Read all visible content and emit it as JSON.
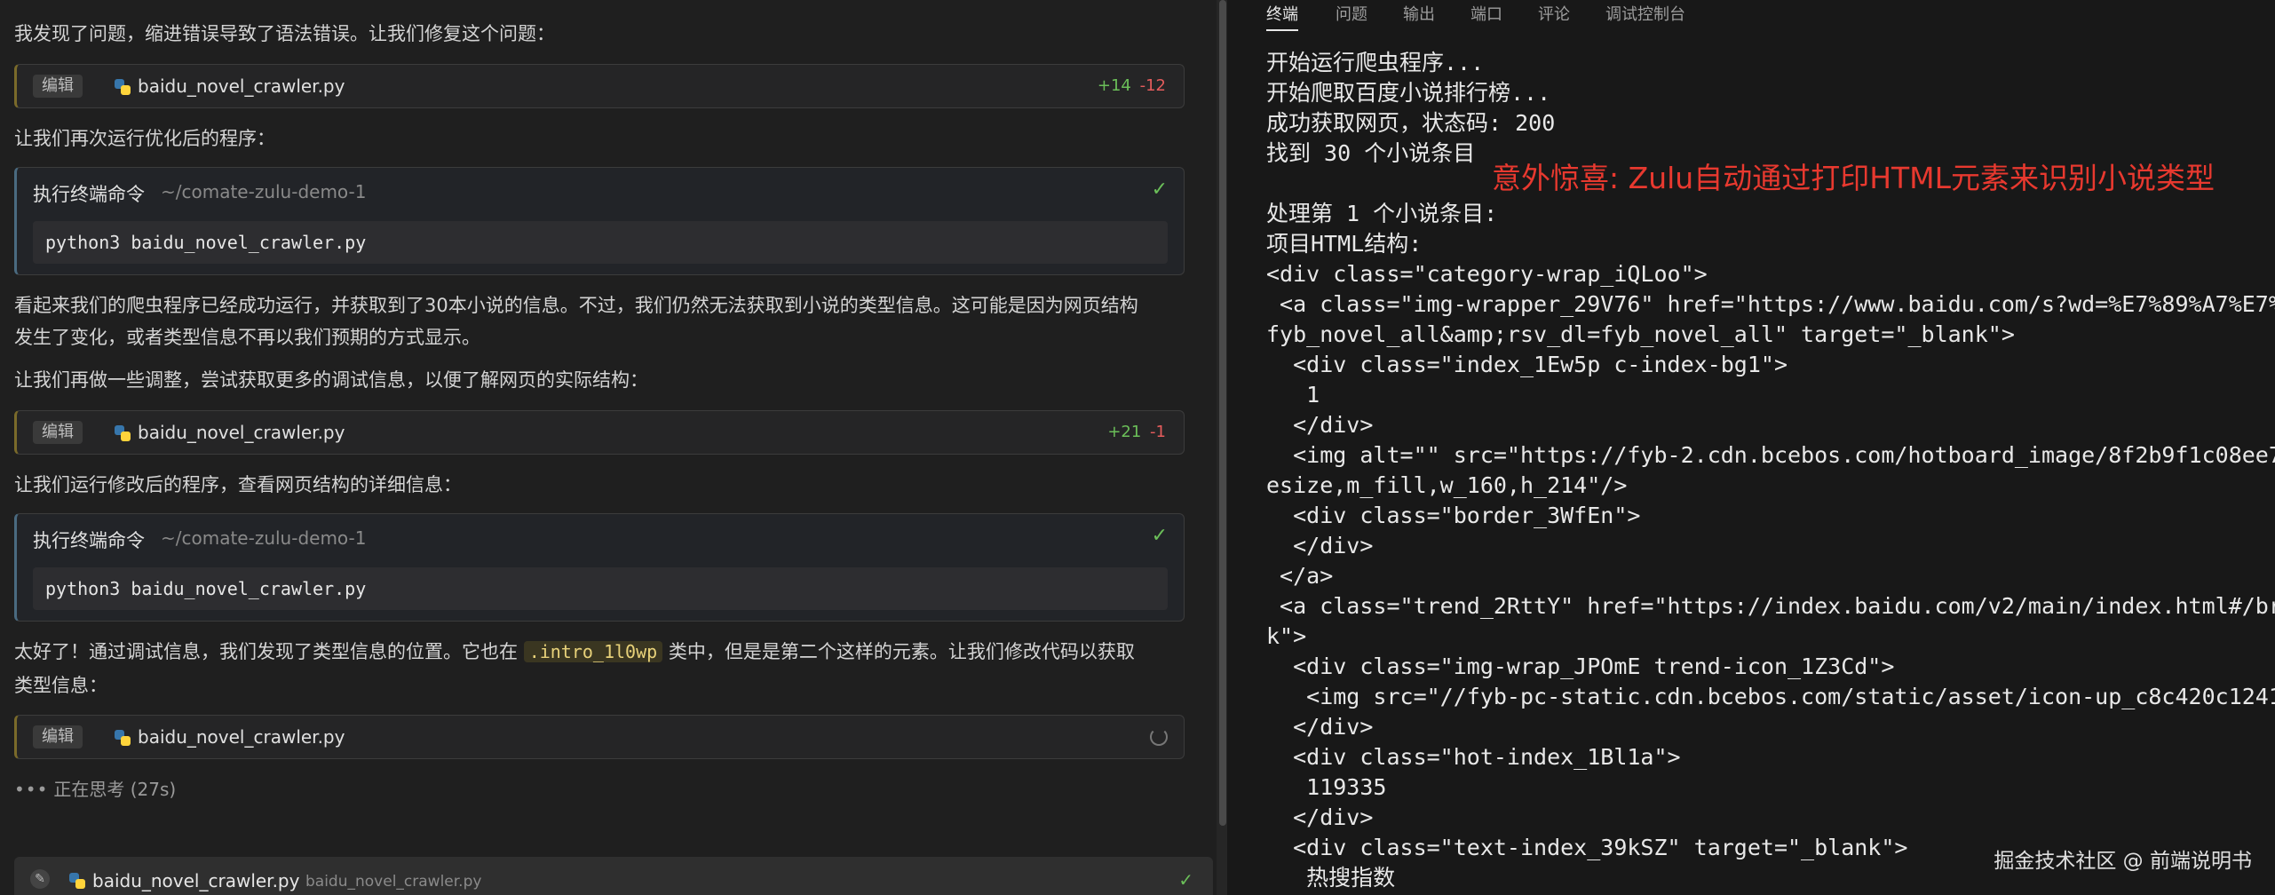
{
  "chat": {
    "msg1": "我发现了问题，缩进错误导致了语法错误。让我们修复这个问题：",
    "edit1": {
      "pill": "编辑",
      "file": "baidu_novel_crawler.py",
      "added": "+14",
      "removed": "-12"
    },
    "msg2": "让我们再次运行优化后的程序：",
    "term1": {
      "title": "执行终端命令",
      "path": "~/comate-zulu-demo-1",
      "command": "python3 baidu_novel_crawler.py"
    },
    "msg3a": "看起来我们的爬虫程序已经成功运行，并获取到了30本小说的信息。不过，我们仍然无法获取到小说的类型信息。这可能是因为网页结构",
    "msg3b": "发生了变化，或者类型信息不再以我们预期的方式显示。",
    "msg4": "让我们再做一些调整，尝试获取更多的调试信息，以便了解网页的实际结构：",
    "edit2": {
      "pill": "编辑",
      "file": "baidu_novel_crawler.py",
      "added": "+21",
      "removed": "-1"
    },
    "msg5": "让我们运行修改后的程序，查看网页结构的详细信息：",
    "term2": {
      "title": "执行终端命令",
      "path": "~/comate-zulu-demo-1",
      "command": "python3 baidu_novel_crawler.py"
    },
    "msg6a_pre": "太好了！通过调试信息，我们发现了类型信息的位置。它也在 ",
    "msg6a_code": ".intro_1l0wp",
    "msg6a_post": " 类中，但是是第二个这样的元素。让我们修改代码以获取",
    "msg6b": "类型信息：",
    "edit3": {
      "pill": "编辑",
      "file": "baidu_novel_crawler.py"
    },
    "thinking": "正在思考 (27s)",
    "bottom": {
      "file": "baidu_novel_crawler.py",
      "sub": "baidu_novel_crawler.py"
    }
  },
  "panel": {
    "tabs": [
      "终端",
      "问题",
      "输出",
      "端口",
      "评论",
      "调试控制台"
    ],
    "active_tab": "终端"
  },
  "terminal_lines": [
    "开始运行爬虫程序...",
    "开始爬取百度小说排行榜...",
    "成功获取网页，状态码: 200",
    "找到 30 个小说条目",
    "",
    "处理第 1 个小说条目:",
    "项目HTML结构:",
    "<div class=\"category-wrap_iQLoo\">",
    " <a class=\"img-wrapper_29V76\" href=\"https://www.baidu.com/s?wd=%E7%89%A7%E7%",
    "fyb_novel_all&amp;rsv_dl=fyb_novel_all\" target=\"_blank\">",
    "  <div class=\"index_1Ew5p c-index-bg1\">",
    "   1",
    "  </div>",
    "  <img alt=\"\" src=\"https://fyb-2.cdn.bcebos.com/hotboard_image/8f2b9f1c08ee7",
    "esize,m_fill,w_160,h_214\"/>",
    "  <div class=\"border_3WfEn\">",
    "  </div>",
    " </a>",
    " <a class=\"trend_2RttY\" href=\"https://index.baidu.com/v2/main/index.html#/br",
    "k\">",
    "  <div class=\"img-wrap_JPOmE trend-icon_1Z3Cd\">",
    "   <img src=\"//fyb-pc-static.cdn.bcebos.com/static/asset/icon-up_c8c420c1241",
    "  </div>",
    "  <div class=\"hot-index_1Bl1a\">",
    "   119335",
    "  </div>",
    "  <div class=\"text-index_39kSZ\" target=\"_blank\">",
    "   热搜指数"
  ],
  "annotation": "意外惊喜: Zulu自动通过打印HTML元素来识别小说类型",
  "watermark": "掘金技术社区 @ 前端说明书",
  "colors": {
    "added": "#6bbf59",
    "removed": "#e55c5c",
    "annotation": "#e8392f"
  }
}
